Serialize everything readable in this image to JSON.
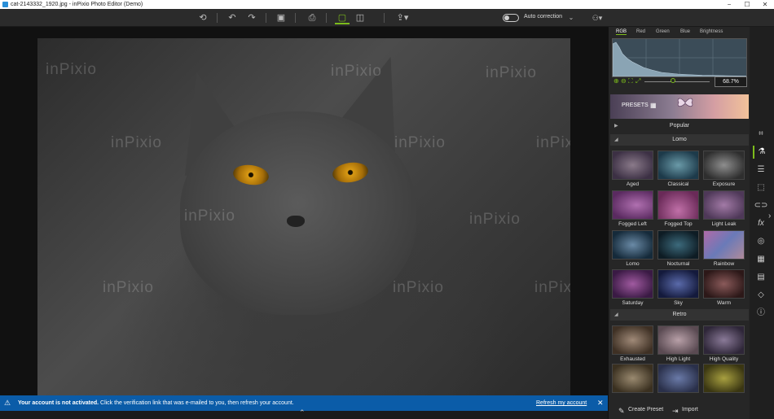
{
  "window": {
    "title": "cat-2143332_1920.jpg - inPixio Photo Editor (Demo)",
    "controls": [
      "−",
      "☐",
      "✕"
    ]
  },
  "toolbar": {
    "undo_all": "⟲",
    "undo": "↶",
    "redo": "↷",
    "save": "▣",
    "print": "⎙",
    "single_view": "▢",
    "compare_view": "◫",
    "share": "⇪▾",
    "auto_correction_label": "Auto correction",
    "auto_correction_on": false,
    "chevron": "⌄",
    "account": "⚇▾"
  },
  "canvas": {
    "watermark_text": "inPixio"
  },
  "notification": {
    "icon": "warning-icon",
    "bold": "Your account is not activated.",
    "text": " Click the verification link that was e-mailed to you, then refresh your account.",
    "link": "Refresh my account",
    "close": "✕",
    "color": "#0b5ca8"
  },
  "histogram": {
    "tabs": [
      "RGB",
      "Red",
      "Green",
      "Blue",
      "Brightness"
    ],
    "selected_tab": "RGB",
    "zoom_icons": [
      "⊕",
      "⊖",
      "⛶",
      "⤢"
    ],
    "zoom_value": "68.7%",
    "zoom_level": 0.687
  },
  "presets": {
    "banner_label": "PRESETS",
    "sections": [
      {
        "label": "Popular",
        "expanded": false
      },
      {
        "label": "Lomo",
        "expanded": true
      },
      {
        "label": "Retro",
        "expanded": true
      }
    ],
    "lomo": [
      "Aged",
      "Classical",
      "Exposure",
      "Fogged Left",
      "Fogged Top",
      "Light Leak",
      "Lomo",
      "Nocturnal",
      "Rainbow",
      "Saturday",
      "Sky",
      "Warm"
    ],
    "retro": [
      "Exhausted",
      "High Light",
      "High Quality",
      "",
      "",
      ""
    ],
    "footer_create": "Create Preset",
    "footer_import": "Import"
  },
  "toolstrip": [
    "⌗",
    "⚗",
    "☰",
    "⬚",
    "⊂⊃",
    "fx",
    "◎",
    "▦",
    "▤",
    "◇",
    "ⓘ"
  ],
  "collapse_icon": "›",
  "accent_color": "#7cbc1b"
}
